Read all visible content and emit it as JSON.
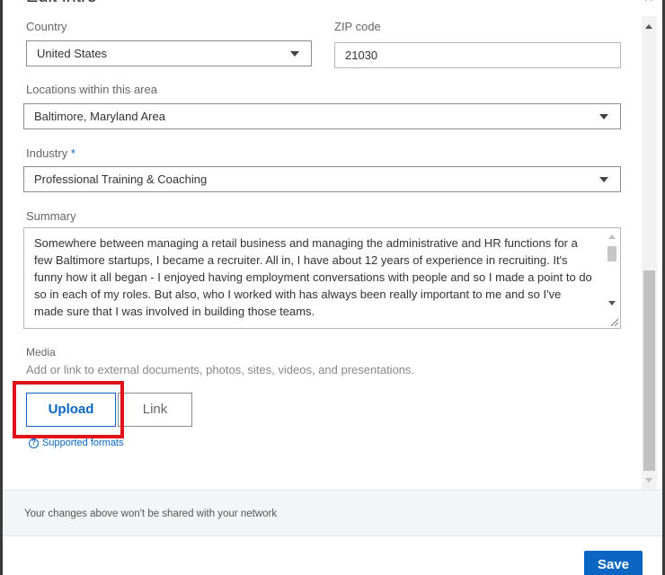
{
  "modal": {
    "title": "Edit intro",
    "close_glyph": "×"
  },
  "country": {
    "label": "Country",
    "value": "United States"
  },
  "zip": {
    "label": "ZIP code",
    "value": "21030"
  },
  "locations": {
    "label": "Locations within this area",
    "value": "Baltimore, Maryland Area"
  },
  "industry": {
    "label": "Industry",
    "required_marker": "*",
    "value": "Professional Training & Coaching"
  },
  "summary": {
    "label": "Summary",
    "text": "Somewhere between managing a retail business and managing the administrative and HR functions for a few Baltimore startups, I became a recruiter. All in, I have about 12 years of experience in recruiting. It's funny how it all began - I enjoyed having employment conversations with people and so I made a point to do so in each of my roles. But also, who I worked with has always been really important to me and so I've made sure that I was involved in building those teams."
  },
  "media": {
    "label": "Media",
    "description": "Add or link to external documents, photos, sites, videos, and presentations.",
    "upload_label": "Upload",
    "link_label": "Link",
    "supported_formats": "Supported formats",
    "help_icon_glyph": "?"
  },
  "footer": {
    "notice": "Your changes above won't be shared with your network",
    "save_label": "Save"
  },
  "colors": {
    "accent": "#0a66c2",
    "highlight": "#e0131a"
  }
}
